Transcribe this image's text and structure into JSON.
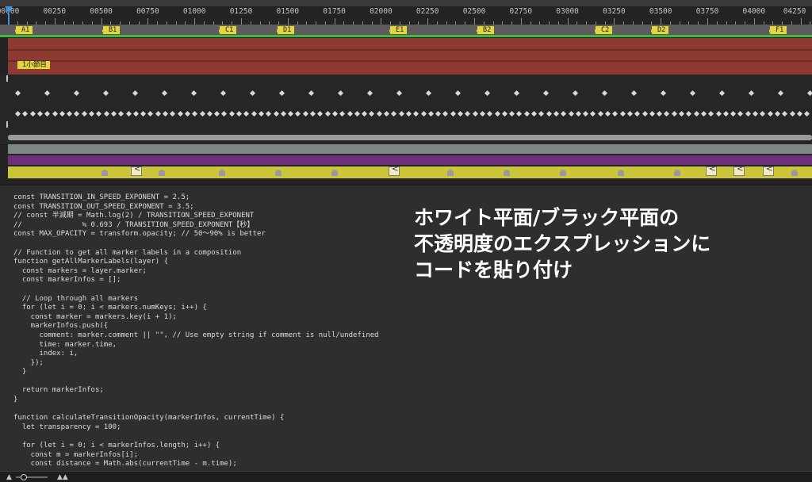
{
  "ruler": {
    "labels": [
      "00000",
      "00250",
      "00500",
      "00750",
      "01000",
      "01250",
      "01500",
      "01750",
      "02000",
      "02250",
      "02500",
      "02750",
      "03000",
      "03250",
      "03500",
      "03750",
      "04000",
      "04250"
    ]
  },
  "markers": [
    "A1",
    "B1",
    "C1",
    "D1",
    "E1",
    "B2",
    "C2",
    "D2",
    "F1"
  ],
  "layer_marker": "1小節目",
  "code_lines": [
    "const TRANSITION_IN_SPEED_EXPONENT = 2.5;",
    "const TRANSITION_OUT_SPEED_EXPONENT = 3.5;",
    "// const 半減期 = Math.log(2) / TRANSITION_SPEED_EXPONENT",
    "//              ≒ 0.693 / TRANSITION_SPEED_EXPONENT【秒】",
    "const MAX_OPACITY = transform.opacity; // 50～90% is better",
    "",
    "// Function to get all marker labels in a composition",
    "function getAllMarkerLabels(layer) {",
    "  const markers = layer.marker;",
    "  const markerInfos = [];",
    "",
    "  // Loop through all markers",
    "  for (let i = 0; i < markers.numKeys; i++) {",
    "    const marker = markers.key(i + 1);",
    "    markerInfos.push({",
    "      comment: marker.comment || \"\", // Use empty string if comment is null/undefined",
    "      time: marker.time,",
    "      index: i,",
    "    });",
    "  }",
    "",
    "  return markerInfos;",
    "}",
    "",
    "function calculateTransitionOpacity(markerInfos, currentTime) {",
    "  let transparency = 100;",
    "",
    "  for (let i = 0; i < markerInfos.length; i++) {",
    "    const m = markerInfos[i];",
    "    const distance = Math.abs(currentTime - m.time);"
  ],
  "caption": {
    "line1": "ホワイト平面/ブラック平面の",
    "line2": "不透明度のエクスプレッションに",
    "line3": "コードを貼り付け"
  },
  "colors": {
    "playhead": "#3d8fe8",
    "work_area": "#3fb93f",
    "marker": "#e3d63c",
    "red_layer": "#8c3a32",
    "purple_layer": "#6c2f7a",
    "yellow_layer": "#ccc53a"
  }
}
